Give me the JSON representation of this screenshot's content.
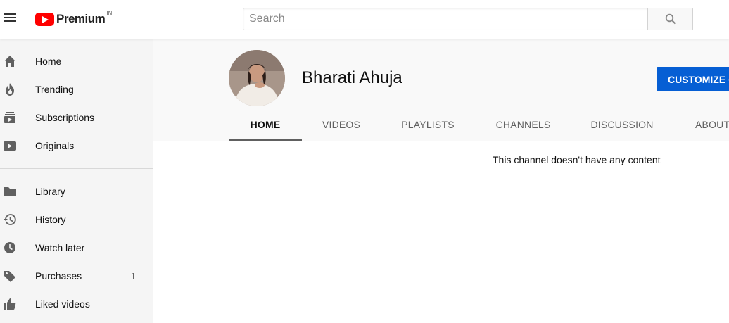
{
  "header": {
    "logo_text": "Premium",
    "logo_country": "IN",
    "search_placeholder": "Search"
  },
  "sidebar": {
    "items": [
      {
        "label": "Home",
        "icon": "home-icon"
      },
      {
        "label": "Trending",
        "icon": "fire-icon"
      },
      {
        "label": "Subscriptions",
        "icon": "subscriptions-icon"
      },
      {
        "label": "Originals",
        "icon": "play-icon"
      },
      {
        "label": "Library",
        "icon": "folder-icon"
      },
      {
        "label": "History",
        "icon": "history-icon"
      },
      {
        "label": "Watch later",
        "icon": "clock-icon"
      },
      {
        "label": "Purchases",
        "icon": "tag-icon",
        "count": "1"
      },
      {
        "label": "Liked videos",
        "icon": "thumbs-up-icon"
      }
    ]
  },
  "channel": {
    "name": "Bharati Ahuja",
    "customize_label": "CUSTOMIZE CHANNEL",
    "tabs": [
      "HOME",
      "VIDEOS",
      "PLAYLISTS",
      "CHANNELS",
      "DISCUSSION",
      "ABOUT"
    ],
    "active_tab": "HOME",
    "empty_message": "This channel doesn't have any content"
  },
  "colors": {
    "brand_red": "#ff0000",
    "accent_blue": "#065fd4",
    "sidebar_bg": "#f5f5f5"
  }
}
